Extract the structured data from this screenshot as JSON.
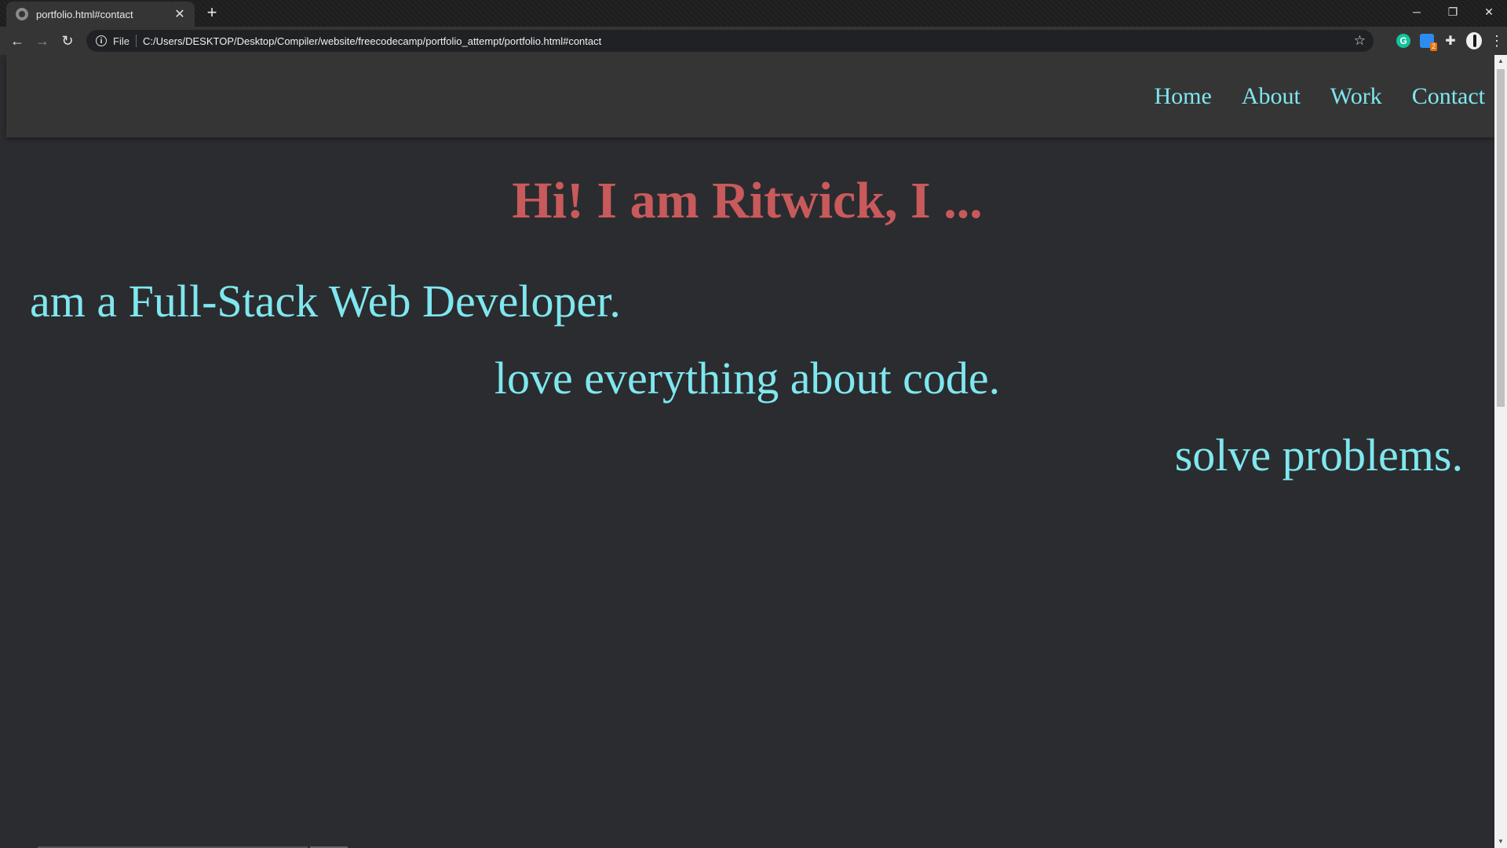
{
  "browser": {
    "tab": {
      "title": "portfolio.html#contact",
      "close_glyph": "✕",
      "favicon": "globe-icon"
    },
    "new_tab_glyph": "+",
    "window_controls": {
      "minimize": "─",
      "restore": "❐",
      "close": "✕"
    },
    "nav": {
      "back": "←",
      "forward": "→",
      "reload": "↻"
    },
    "omnibox": {
      "info_glyph": "i",
      "scheme_label": "File",
      "url": "C:/Users/DESKTOP/Desktop/Compiler/website/freecodecamp/portfolio_attempt/portfolio.html#contact",
      "star_glyph": "☆"
    },
    "extensions": {
      "grammarly": "G",
      "todo_badge": "2",
      "puzzle": "✚",
      "menu": "⋮"
    }
  },
  "site": {
    "nav_links": [
      "Home",
      "About",
      "Work",
      "Contact"
    ],
    "hero_title": "Hi! I am Ritwick, I ...",
    "roles": [
      "am a Full-Stack Web Developer.",
      "love everything about code.",
      "solve problems."
    ],
    "colors": {
      "background": "#2b2c2f",
      "nav_background": "#353535",
      "accent_cyan": "#7fe7ef",
      "title_red": "#c85a5c"
    }
  },
  "scrollbar": {
    "up": "▲",
    "down": "▼"
  }
}
